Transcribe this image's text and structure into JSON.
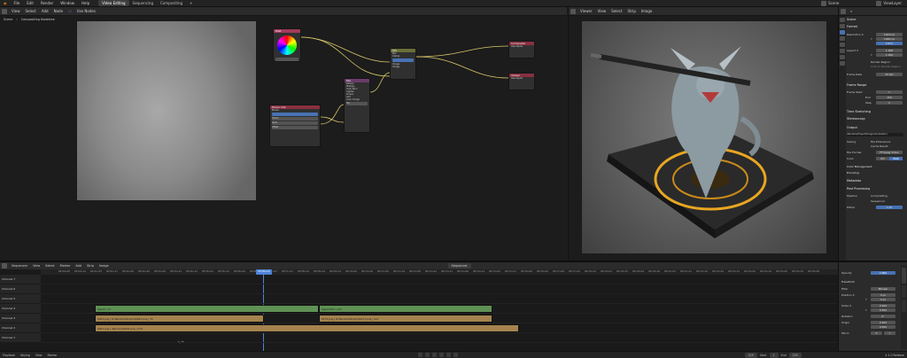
{
  "menu": [
    "File",
    "Edit",
    "Render",
    "Window",
    "Help"
  ],
  "workspaces": [
    {
      "label": "Video Editing",
      "active": true
    },
    {
      "label": "Sequencing",
      "active": false
    },
    {
      "label": "Compositing",
      "active": false
    }
  ],
  "top_right": {
    "scene": "Scene",
    "view_layer": "ViewLayer"
  },
  "compositor": {
    "header": [
      "View",
      "Select",
      "Add",
      "Node"
    ],
    "use_nodes": "Use Nodes",
    "breadcrumb": [
      "Scene",
      "Compositing Nodetree"
    ],
    "nodes": {
      "rgb": "RGB",
      "viewer": "Viewer",
      "mix": "Mix",
      "movie_clip": "Movie Clip",
      "mix_color": "Mix",
      "composite": "Composite",
      "composite_alpha": "Use Alpha",
      "viewer2": "Viewer",
      "viewer2_alpha": "Use Alpha"
    },
    "mix_rows": [
      "Mix",
      "Clamp",
      "Fac",
      "Image",
      "Image"
    ],
    "mix2_rows": [
      "Darken",
      "Multiply",
      "Color Burn",
      "Lighten",
      "Screen",
      "Add",
      "Color Dodge",
      "Fac"
    ],
    "clip_rows": [
      "Movie",
      "Frame",
      "Start",
      "Offset"
    ]
  },
  "preview": {
    "header": [
      "Viewer",
      "View",
      "Select",
      "Strip",
      "Image"
    ]
  },
  "properties": {
    "title": "Scene",
    "format_section": "Format",
    "resolution_x_label": "Resolution X",
    "resolution_x": "1920 px",
    "resolution_y_label": "Y",
    "resolution_y": "1080 px",
    "percent": "100%",
    "aspect_x_label": "Aspect X",
    "aspect_x": "1.000",
    "aspect_y_label": "Y",
    "aspect_y": "1.000",
    "render_region": "Render Region",
    "crop_region": "Crop to Render Region",
    "frame_rate_label": "Frame Rate",
    "frame_rate": "25 fps",
    "frame_range_section": "Frame Range",
    "frame_start_label": "Frame Start",
    "frame_start": "1",
    "frame_end_label": "End",
    "frame_end": "150",
    "step_label": "Step",
    "step": "1",
    "time_stretching": "Time Stretching",
    "stereoscopy": "Stereoscopy",
    "output_section": "Output",
    "output_path": "/Renders/Project/DragonAnimation/",
    "saving_label": "Saving",
    "file_extensions": "File Extensions",
    "cache_result": "Cache Result",
    "file_format_label": "File Format",
    "file_format": "FFmpeg Video",
    "color_label": "Color",
    "color_bw": "BW",
    "color_rgb": "RGB",
    "color_mgmt": "Color Management",
    "encoding": "Encoding",
    "metadata": "Metadata",
    "post_processing": "Post Processing",
    "pipeline_label": "Pipeline",
    "compositing": "Compositing",
    "sequencer": "Sequencer",
    "dither_label": "Dither",
    "dither": "1.00"
  },
  "sequencer": {
    "header": [
      "Sequencer",
      "View",
      "Select",
      "Marker",
      "Add",
      "Strip",
      "Image"
    ],
    "view_mode": "Sequencer",
    "timecodes": [
      "00:00+00",
      "00:00+14",
      "00:01+03",
      "00:01+17",
      "00:02+06",
      "00:02+20",
      "00:03+09",
      "00:03+23",
      "00:04+12",
      "00:05+01",
      "00:05+15",
      "00:06+04",
      "00:06+18",
      "00:07+07",
      "00:07+21",
      "00:08+10",
      "00:08+24",
      "00:09+13",
      "00:10+02",
      "00:10+16",
      "00:11+05",
      "00:11+19",
      "00:12+08",
      "00:12+22",
      "00:13+11",
      "00:14+00",
      "00:14+14",
      "00:15+03",
      "00:15+17",
      "00:16+06",
      "00:16+20",
      "00:17+09",
      "00:17+23",
      "00:18+12",
      "00:19+01",
      "00:19+15",
      "00:20+04",
      "00:20+18",
      "00:21+07",
      "00:21+21",
      "00:22+10",
      "00:22+24",
      "00:23+13",
      "00:24+02",
      "00:24+16",
      "00:25+05",
      "00:25+19",
      "00:26+08",
      "00:26+22",
      "00:27+11",
      "00:28+00",
      "00:28+14"
    ],
    "playhead": "00:09+20",
    "channels": [
      "Channel 7",
      "Channel 6",
      "Channel 5",
      "Channel 4",
      "Channel 3",
      "Channel 2",
      "Channel 1"
    ],
    "strips": [
      {
        "label": "Speed | 74",
        "color": "green",
        "channel": 4,
        "start": 107,
        "end": 360
      },
      {
        "label": "Speed.001 | 141",
        "color": "green",
        "channel": 4,
        "start": 360,
        "end": 556
      },
      {
        "label": "0043.png | D:\\Renders\\Project\\0043.png | 74",
        "color": "tan",
        "channel": 3,
        "start": 107,
        "end": 298
      },
      {
        "label": "0173.png | D:\\Renders\\Project\\0173.png | 141",
        "color": "tan",
        "channel": 3,
        "start": 360,
        "end": 556
      },
      {
        "label": "0001.png | /Renders/0001.png | 179",
        "color": "tan",
        "channel": 2,
        "start": 107,
        "end": 586
      }
    ],
    "frame_marker": "F_28"
  },
  "strip_panel": {
    "opacity_label": "Opacity",
    "opacity": "1.000",
    "transform_section": "Transform",
    "filter_label": "Filter",
    "filter": "Bilinear",
    "position_x_label": "Position X",
    "position_x": "0 px",
    "position_y_label": "Y",
    "position_y": "0 px",
    "scale_x_label": "Scale X",
    "scale_x": "0.500",
    "scale_y_label": "Y",
    "scale_y": "0.500",
    "rotation_label": "Rotation",
    "rotation": "0°",
    "origin_label": "Origin",
    "origin_x": "0.500",
    "origin_y": "0.500",
    "mirror_label": "Mirror",
    "mirror_x": "X",
    "mirror_y": "Y"
  },
  "status": {
    "playback": "Playback",
    "keying": "Keying",
    "view": "View",
    "marker": "Marker",
    "frame": "229",
    "start_label": "Start",
    "start": "1",
    "end_label": "End",
    "end": "229",
    "version": "4.1.0 Release"
  },
  "colors": {
    "accent": "#4772b3",
    "green_strip": "#5f9154",
    "tan_strip": "#a5834e",
    "playhead": "#4d83d8"
  }
}
